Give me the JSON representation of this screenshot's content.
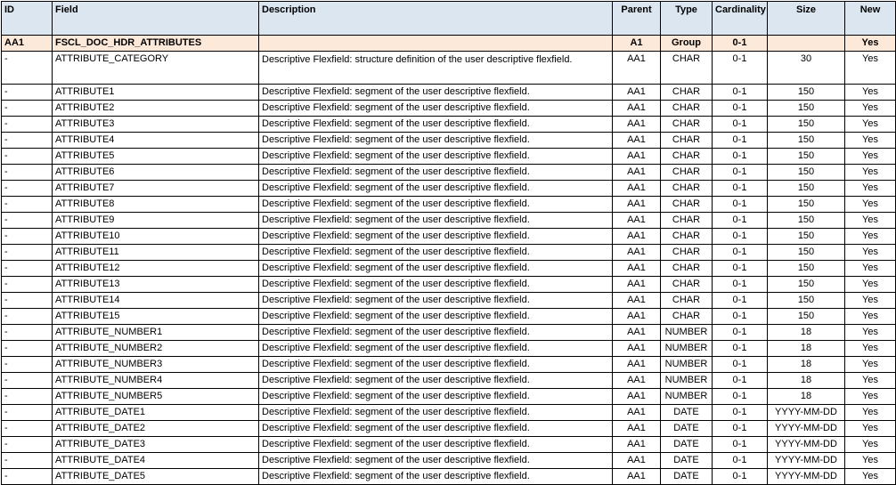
{
  "table": {
    "headers": [
      "ID",
      "Field",
      "Description",
      "Parent",
      "Type",
      "Cardinality",
      "Size",
      "New"
    ],
    "rows": [
      [
        "AA1",
        "FSCL_DOC_HDR_ATTRIBUTES",
        "",
        "A1",
        "Group",
        "0-1",
        "",
        "Yes"
      ],
      [
        "-",
        "ATTRIBUTE_CATEGORY",
        "Descriptive Flexfield: structure definition of the user descriptive flexfield.",
        "AA1",
        "CHAR",
        "0-1",
        "30",
        "Yes"
      ],
      [
        "-",
        "ATTRIBUTE1",
        "Descriptive Flexfield: segment of the user descriptive flexfield.",
        "AA1",
        "CHAR",
        "0-1",
        "150",
        "Yes"
      ],
      [
        "-",
        "ATTRIBUTE2",
        "Descriptive Flexfield: segment of the user descriptive flexfield.",
        "AA1",
        "CHAR",
        "0-1",
        "150",
        "Yes"
      ],
      [
        "-",
        "ATTRIBUTE3",
        "Descriptive Flexfield: segment of the user descriptive flexfield.",
        "AA1",
        "CHAR",
        "0-1",
        "150",
        "Yes"
      ],
      [
        "-",
        "ATTRIBUTE4",
        "Descriptive Flexfield: segment of the user descriptive flexfield.",
        "AA1",
        "CHAR",
        "0-1",
        "150",
        "Yes"
      ],
      [
        "-",
        "ATTRIBUTE5",
        "Descriptive Flexfield: segment of the user descriptive flexfield.",
        "AA1",
        "CHAR",
        "0-1",
        "150",
        "Yes"
      ],
      [
        "-",
        "ATTRIBUTE6",
        "Descriptive Flexfield: segment of the user descriptive flexfield.",
        "AA1",
        "CHAR",
        "0-1",
        "150",
        "Yes"
      ],
      [
        "-",
        "ATTRIBUTE7",
        "Descriptive Flexfield: segment of the user descriptive flexfield.",
        "AA1",
        "CHAR",
        "0-1",
        "150",
        "Yes"
      ],
      [
        "-",
        "ATTRIBUTE8",
        "Descriptive Flexfield: segment of the user descriptive flexfield.",
        "AA1",
        "CHAR",
        "0-1",
        "150",
        "Yes"
      ],
      [
        "-",
        "ATTRIBUTE9",
        "Descriptive Flexfield: segment of the user descriptive flexfield.",
        "AA1",
        "CHAR",
        "0-1",
        "150",
        "Yes"
      ],
      [
        "-",
        "ATTRIBUTE10",
        "Descriptive Flexfield: segment of the user descriptive flexfield.",
        "AA1",
        "CHAR",
        "0-1",
        "150",
        "Yes"
      ],
      [
        "-",
        "ATTRIBUTE11",
        "Descriptive Flexfield: segment of the user descriptive flexfield.",
        "AA1",
        "CHAR",
        "0-1",
        "150",
        "Yes"
      ],
      [
        "-",
        "ATTRIBUTE12",
        "Descriptive Flexfield: segment of the user descriptive flexfield.",
        "AA1",
        "CHAR",
        "0-1",
        "150",
        "Yes"
      ],
      [
        "-",
        "ATTRIBUTE13",
        "Descriptive Flexfield: segment of the user descriptive flexfield.",
        "AA1",
        "CHAR",
        "0-1",
        "150",
        "Yes"
      ],
      [
        "-",
        "ATTRIBUTE14",
        "Descriptive Flexfield: segment of the user descriptive flexfield.",
        "AA1",
        "CHAR",
        "0-1",
        "150",
        "Yes"
      ],
      [
        "-",
        "ATTRIBUTE15",
        "Descriptive Flexfield: segment of the user descriptive flexfield.",
        "AA1",
        "CHAR",
        "0-1",
        "150",
        "Yes"
      ],
      [
        "-",
        "ATTRIBUTE_NUMBER1",
        "Descriptive Flexfield: segment of the user descriptive flexfield.",
        "AA1",
        "NUMBER",
        "0-1",
        "18",
        "Yes"
      ],
      [
        "-",
        "ATTRIBUTE_NUMBER2",
        "Descriptive Flexfield: segment of the user descriptive flexfield.",
        "AA1",
        "NUMBER",
        "0-1",
        "18",
        "Yes"
      ],
      [
        "-",
        "ATTRIBUTE_NUMBER3",
        "Descriptive Flexfield: segment of the user descriptive flexfield.",
        "AA1",
        "NUMBER",
        "0-1",
        "18",
        "Yes"
      ],
      [
        "-",
        "ATTRIBUTE_NUMBER4",
        "Descriptive Flexfield: segment of the user descriptive flexfield.",
        "AA1",
        "NUMBER",
        "0-1",
        "18",
        "Yes"
      ],
      [
        "-",
        "ATTRIBUTE_NUMBER5",
        "Descriptive Flexfield: segment of the user descriptive flexfield.",
        "AA1",
        "NUMBER",
        "0-1",
        "18",
        "Yes"
      ],
      [
        "-",
        "ATTRIBUTE_DATE1",
        "Descriptive Flexfield: segment of the user descriptive flexfield.",
        "AA1",
        "DATE",
        "0-1",
        "YYYY-MM-DD",
        "Yes"
      ],
      [
        "-",
        "ATTRIBUTE_DATE2",
        "Descriptive Flexfield: segment of the user descriptive flexfield.",
        "AA1",
        "DATE",
        "0-1",
        "YYYY-MM-DD",
        "Yes"
      ],
      [
        "-",
        "ATTRIBUTE_DATE3",
        "Descriptive Flexfield: segment of the user descriptive flexfield.",
        "AA1",
        "DATE",
        "0-1",
        "YYYY-MM-DD",
        "Yes"
      ],
      [
        "-",
        "ATTRIBUTE_DATE4",
        "Descriptive Flexfield: segment of the user descriptive flexfield.",
        "AA1",
        "DATE",
        "0-1",
        "YYYY-MM-DD",
        "Yes"
      ],
      [
        "-",
        "ATTRIBUTE_DATE5",
        "Descriptive Flexfield: segment of the user descriptive flexfield.",
        "AA1",
        "DATE",
        "0-1",
        "YYYY-MM-DD",
        "Yes"
      ]
    ]
  }
}
